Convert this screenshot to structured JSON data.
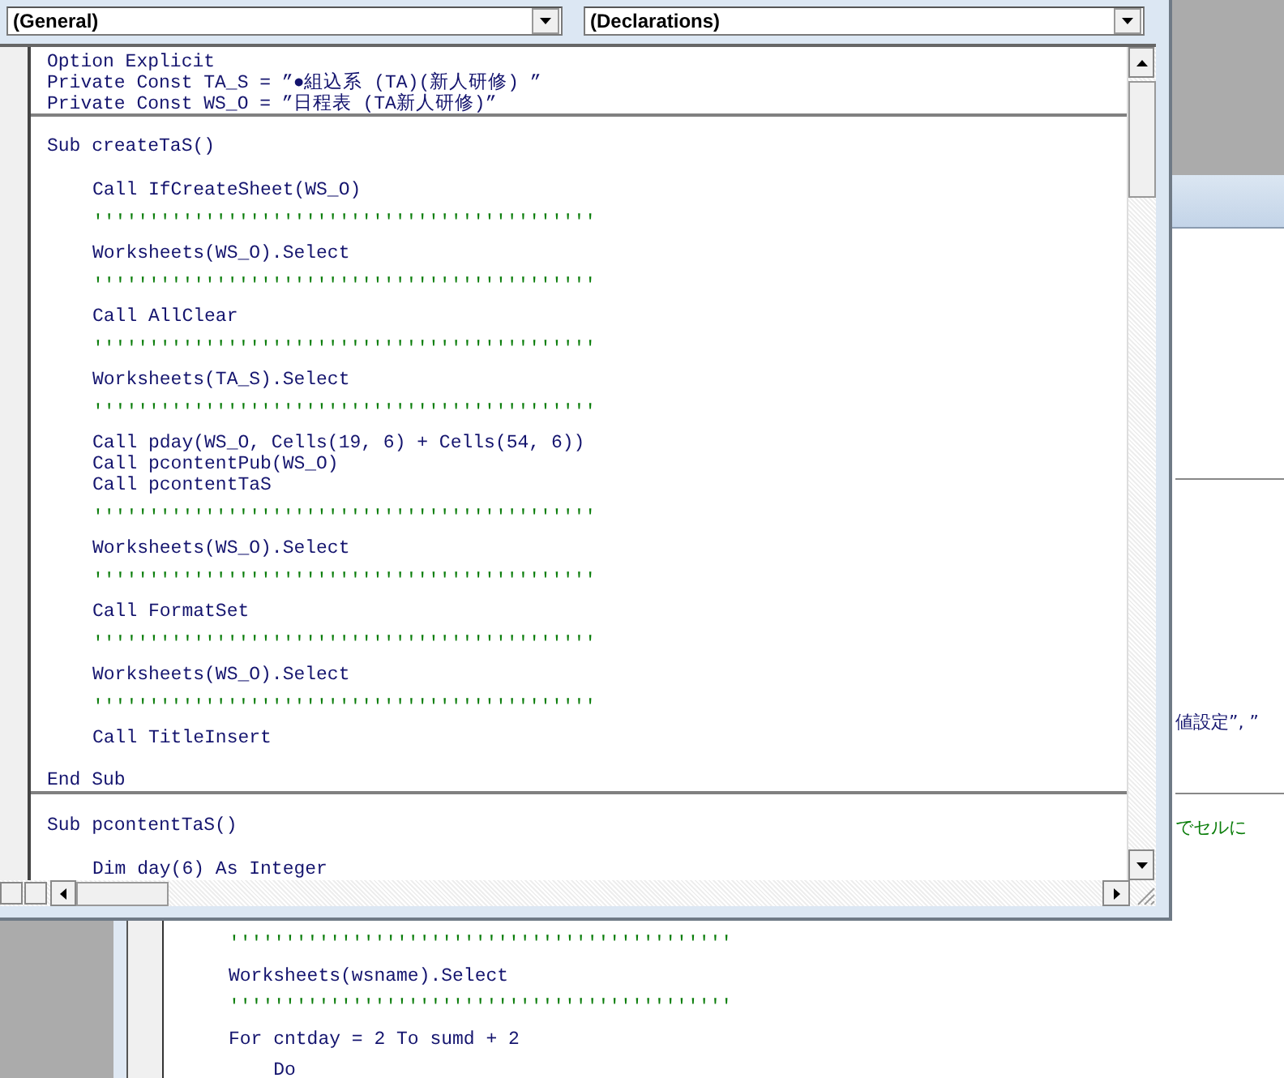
{
  "background_window": {
    "right_lines": [
      {
        "kind": "code",
        "text": "値設定”, ”"
      },
      {
        "kind": "comment",
        "text": "でセルに"
      }
    ],
    "code_lines": [
      {
        "kind": "comment",
        "text": "'''''''''''''''''''''''''''''''''''''''''''''"
      },
      {
        "kind": "code",
        "text": "Worksheets(wsname).Select"
      },
      {
        "kind": "comment",
        "text": "'''''''''''''''''''''''''''''''''''''''''''''"
      },
      {
        "kind": "code",
        "text": "For cntday = 2 To sumd + 2"
      },
      {
        "kind": "code",
        "text": "    Do"
      }
    ]
  },
  "code_window": {
    "object_combo": "(General)",
    "procedure_combo": "(Declarations)",
    "declarations": [
      "Option Explicit",
      "Private Const TA_S = ”●組込系 (TA)(新人研修) ”",
      "Private Const WS_O = ”日程表 (TA新人研修)”"
    ],
    "procedures": [
      {
        "header": "Sub createTaS()",
        "groups": [
          [
            {
              "kind": "code",
              "text": "Call IfCreateSheet(WS_O)"
            }
          ],
          [
            {
              "kind": "comment",
              "text": "'''''''''''''''''''''''''''''''''''''''''''''"
            }
          ],
          [
            {
              "kind": "code",
              "text": "Worksheets(WS_O).Select"
            }
          ],
          [
            {
              "kind": "comment",
              "text": "'''''''''''''''''''''''''''''''''''''''''''''"
            }
          ],
          [
            {
              "kind": "code",
              "text": "Call AllClear"
            }
          ],
          [
            {
              "kind": "comment",
              "text": "'''''''''''''''''''''''''''''''''''''''''''''"
            }
          ],
          [
            {
              "kind": "code",
              "text": "Worksheets(TA_S).Select"
            }
          ],
          [
            {
              "kind": "comment",
              "text": "'''''''''''''''''''''''''''''''''''''''''''''"
            }
          ],
          [
            {
              "kind": "code",
              "text": "Call pday(WS_O, Cells(19, 6) + Cells(54, 6))"
            },
            {
              "kind": "code",
              "text": "Call pcontentPub(WS_O)"
            },
            {
              "kind": "code",
              "text": "Call pcontentTaS"
            }
          ],
          [
            {
              "kind": "comment",
              "text": "'''''''''''''''''''''''''''''''''''''''''''''"
            }
          ],
          [
            {
              "kind": "code",
              "text": "Worksheets(WS_O).Select"
            }
          ],
          [
            {
              "kind": "comment",
              "text": "'''''''''''''''''''''''''''''''''''''''''''''"
            }
          ],
          [
            {
              "kind": "code",
              "text": "Call FormatSet"
            }
          ],
          [
            {
              "kind": "comment",
              "text": "'''''''''''''''''''''''''''''''''''''''''''''"
            }
          ],
          [
            {
              "kind": "code",
              "text": "Worksheets(WS_O).Select"
            }
          ],
          [
            {
              "kind": "comment",
              "text": "'''''''''''''''''''''''''''''''''''''''''''''"
            }
          ],
          [
            {
              "kind": "code",
              "text": "Call TitleInsert"
            }
          ]
        ],
        "footer": "End Sub"
      },
      {
        "header": "Sub pcontentTaS()",
        "groups": [
          [
            {
              "kind": "code",
              "text": "Dim day(6) As Integer"
            }
          ]
        ]
      }
    ]
  }
}
